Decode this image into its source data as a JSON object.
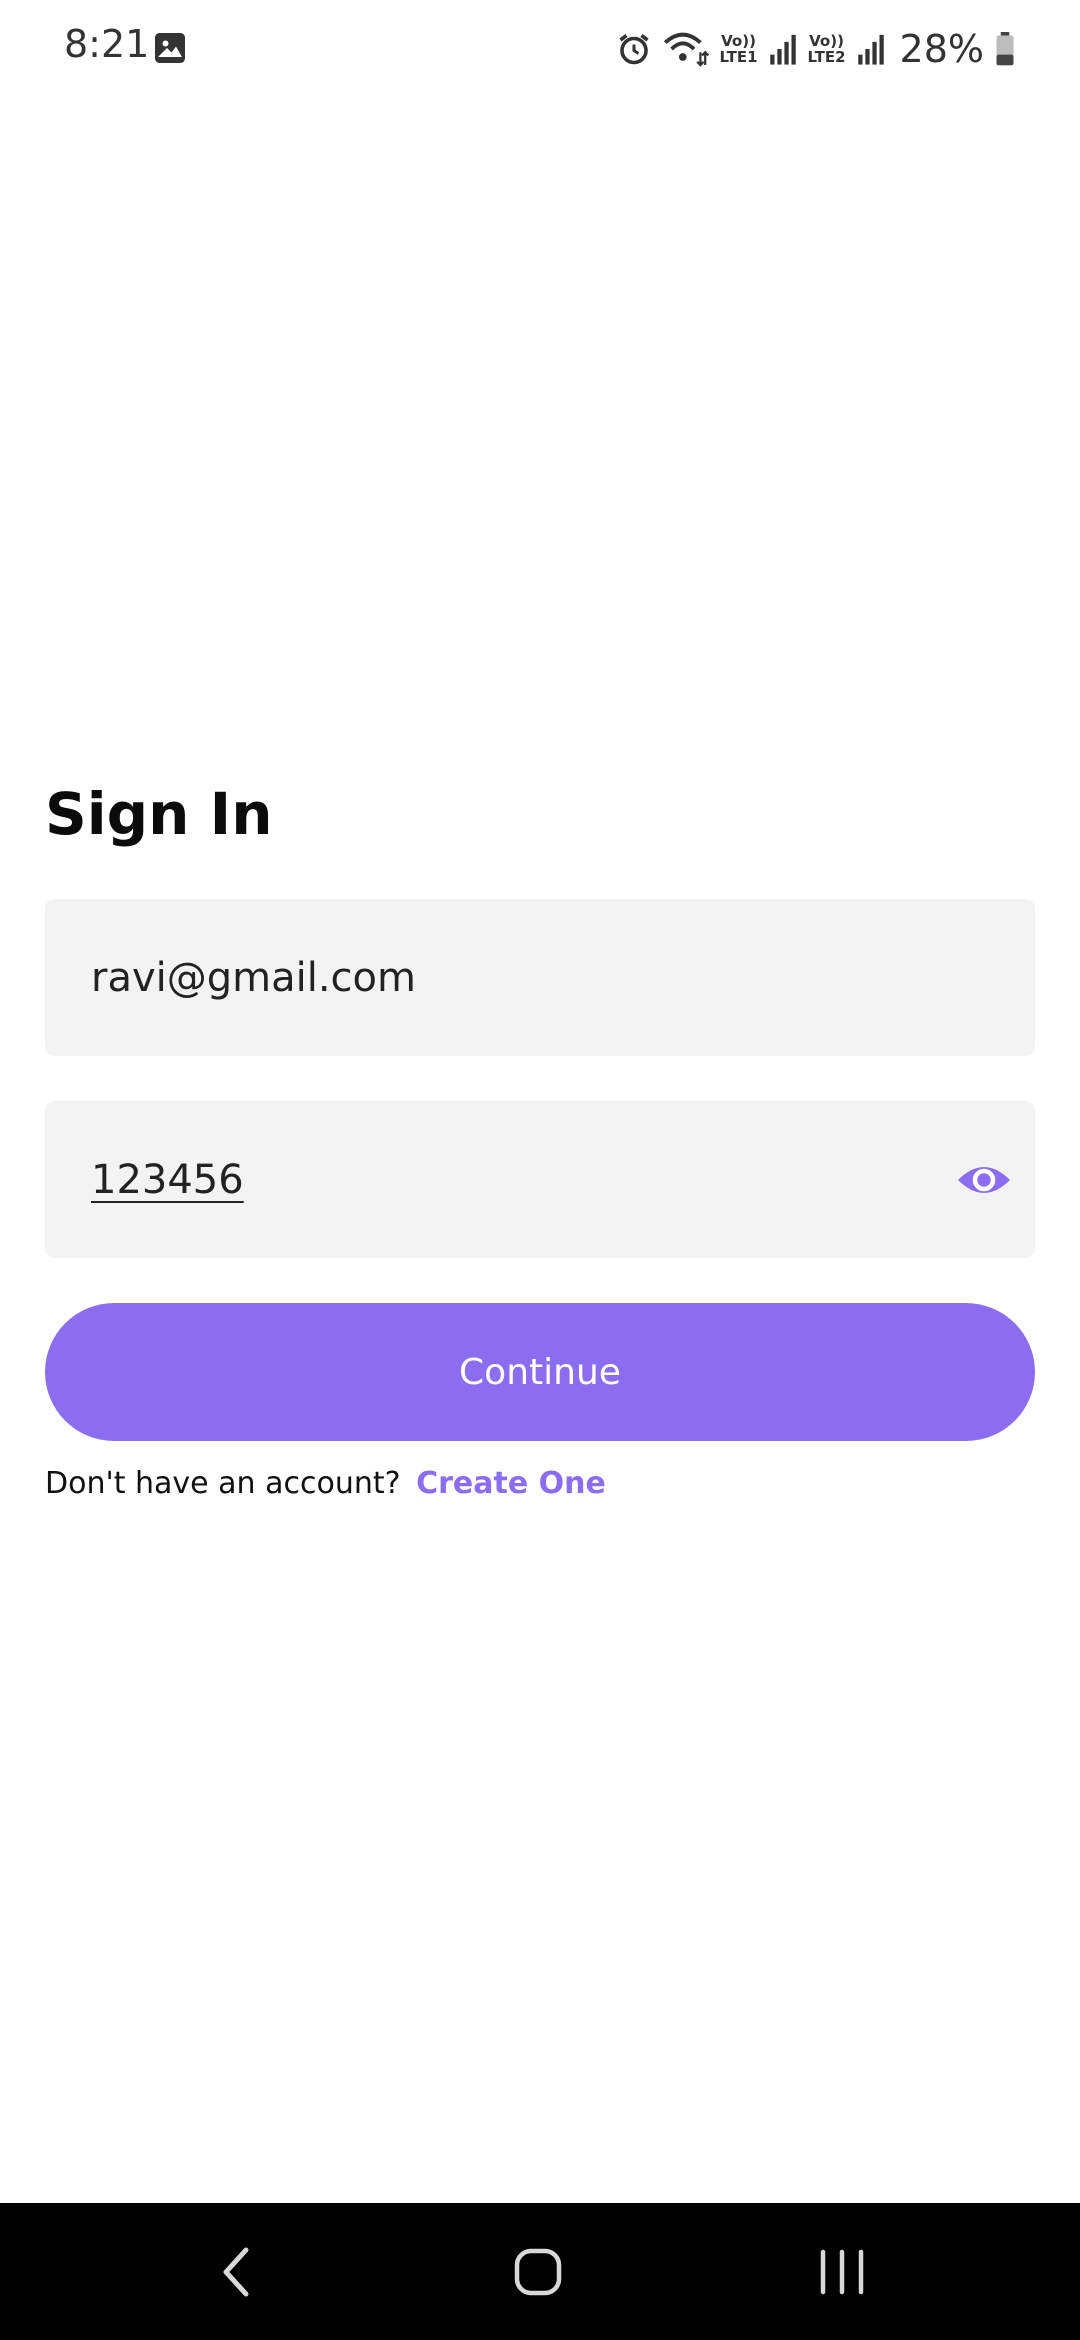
{
  "status_bar": {
    "time": "8:21",
    "net1_top": "Vo))",
    "net1_bottom": "LTE1",
    "net2_top": "Vo))",
    "net2_bottom": "LTE2",
    "battery": "28%",
    "icons": [
      "gallery-icon",
      "alarm-icon",
      "wifi-icon",
      "signal-icon",
      "battery-icon"
    ]
  },
  "signin": {
    "title": "Sign In",
    "email_value": "ravi@gmail.com",
    "password_value": "123456",
    "continue_label": "Continue",
    "no_account_text": "Don't have an account?",
    "create_link": "Create One"
  },
  "colors": {
    "accent": "#8b6ef0",
    "field_bg": "#f3f3f3",
    "nav_bg": "#000000"
  },
  "nav_bar": {
    "icons": [
      "back-icon",
      "home-icon",
      "recent-apps-icon"
    ]
  }
}
